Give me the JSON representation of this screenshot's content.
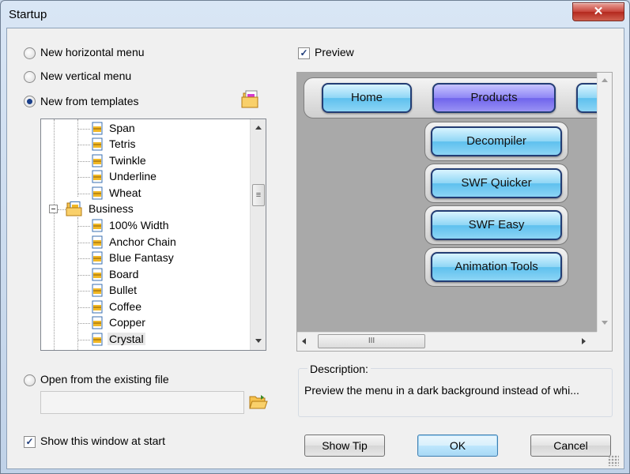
{
  "window": {
    "title": "Startup",
    "close_glyph": "✕",
    "accent": "#c7443a"
  },
  "options": {
    "new_horizontal": "New horizontal menu",
    "new_vertical": "New vertical menu",
    "new_from_templates": "New from templates",
    "open_existing": "Open from the existing file",
    "open_file_value": "",
    "show_at_start": "Show this window at start",
    "preview": "Preview",
    "selected": "new_from_templates"
  },
  "tree": {
    "group": "Business",
    "items_top": [
      "Span",
      "Tetris",
      "Twinkle",
      "Underline",
      "Wheat"
    ],
    "items_business": [
      "100% Width",
      "Anchor Chain",
      "Blue Fantasy",
      "Board",
      "Bullet",
      "Coffee",
      "Copper",
      "Crystal"
    ],
    "selected": "Crystal",
    "scroll_grip": "≡"
  },
  "preview_menu": {
    "top_items": [
      "Home",
      "Products",
      ""
    ],
    "active": "Products",
    "sub_items": [
      "Decompiler",
      "SWF Quicker",
      "SWF Easy",
      "Animation Tools"
    ],
    "hscroll_grip": "III",
    "colors": {
      "button": "#8fd6f5",
      "active": "#8e86f5",
      "canvas": "#a9a9a9"
    }
  },
  "description": {
    "title": "Description:",
    "text": "Preview the menu in a dark background instead of whi..."
  },
  "buttons": {
    "show_tip": "Show Tip",
    "ok": "OK",
    "cancel": "Cancel"
  }
}
